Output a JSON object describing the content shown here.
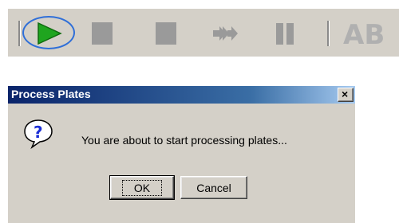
{
  "toolbar": {
    "buttons": [
      {
        "icon": "play-icon",
        "state": "highlighted"
      },
      {
        "icon": "stop-icon",
        "state": "disabled"
      },
      {
        "icon": "stop-icon",
        "state": "disabled"
      },
      {
        "icon": "skip-icon",
        "state": "disabled"
      },
      {
        "icon": "pause-icon",
        "state": "disabled"
      }
    ],
    "logo_text": "AB"
  },
  "dialog": {
    "title": "Process Plates",
    "close_label": "×",
    "icon": "question-icon",
    "message": "You are about to start processing plates...",
    "ok_label": "OK",
    "cancel_label": "Cancel"
  },
  "colors": {
    "highlight_ring": "#2f6fd8",
    "play_green": "#1fa51f",
    "disabled_gray": "#9a9a9a",
    "title_bar": "#0a246a",
    "dialog_face": "#d4d0c8"
  }
}
